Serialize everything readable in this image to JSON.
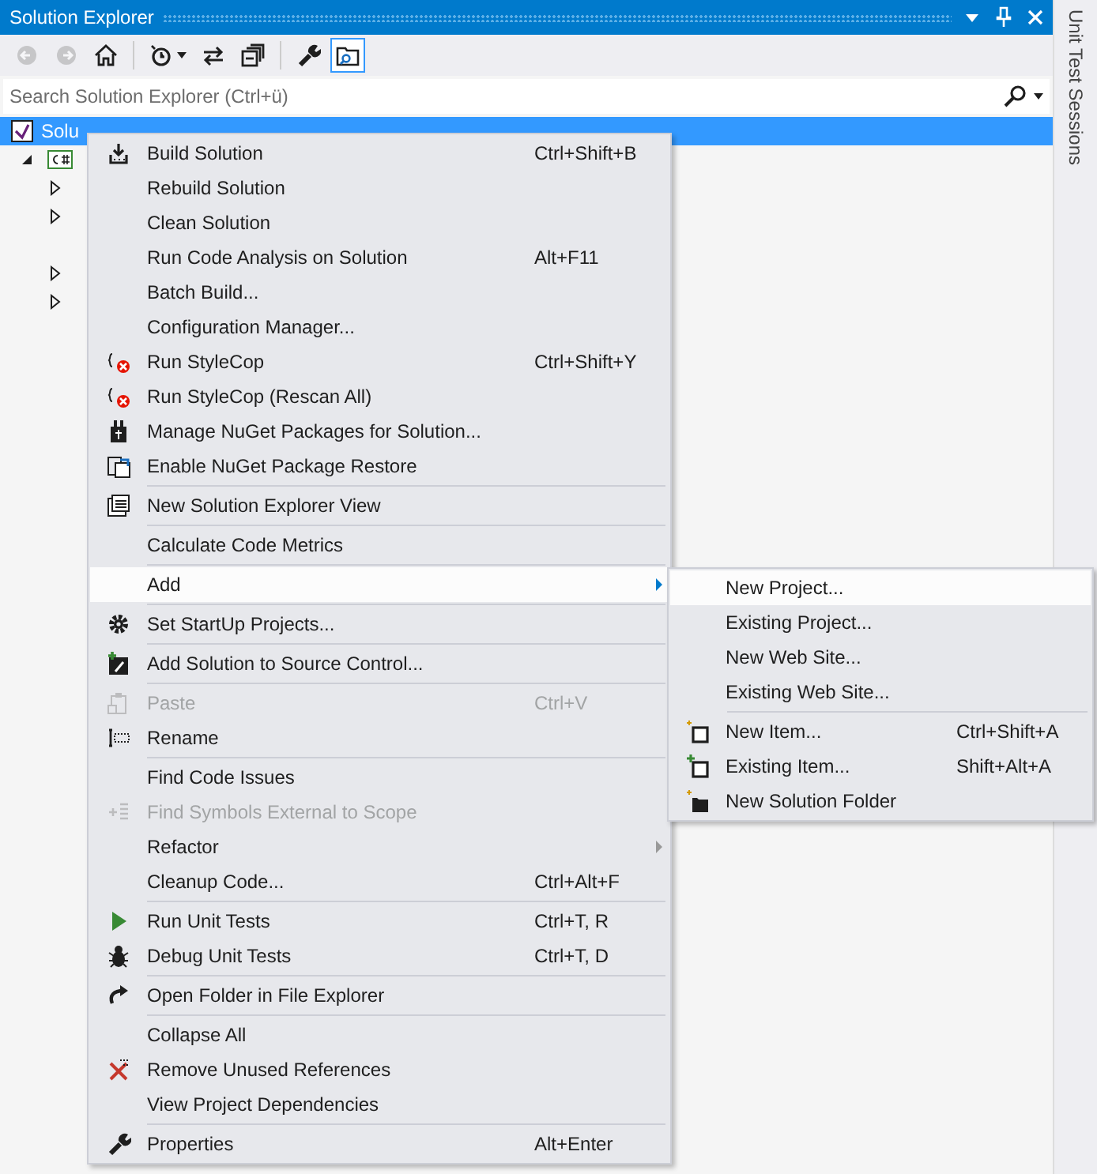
{
  "window": {
    "title": "Solution Explorer"
  },
  "side_tab": {
    "label": "Unit Test Sessions"
  },
  "toolbar": [
    {
      "kind": "button",
      "disabled": true,
      "selected": false
    },
    {
      "kind": "button",
      "disabled": true,
      "selected": false
    },
    {
      "kind": "button",
      "disabled": false,
      "selected": false
    },
    {
      "kind": "separator"
    },
    {
      "kind": "dropdown",
      "disabled": false,
      "selected": false
    },
    {
      "kind": "button",
      "disabled": false,
      "selected": false
    },
    {
      "kind": "button",
      "disabled": false,
      "selected": false
    },
    {
      "kind": "separator"
    },
    {
      "kind": "button",
      "disabled": false,
      "selected": false
    },
    {
      "kind": "button",
      "disabled": false,
      "selected": true
    }
  ],
  "search": {
    "placeholder": "Search Solution Explorer (Ctrl+ü)"
  },
  "tree": [
    {
      "label": "Solu",
      "selected": true,
      "children": [
        {
          "expanded": true,
          "selected": false,
          "children": [
            {
              "expanded": false,
              "selected": false
            },
            {
              "expanded": false,
              "selected": false
            },
            {
              "selected": false
            },
            {
              "expanded": false,
              "selected": false
            },
            {
              "expanded": false,
              "selected": false
            }
          ]
        }
      ]
    }
  ],
  "context_menu": {
    "groups": [
      {
        "items": [
          {
            "label": "Build Solution",
            "shortcut": "Ctrl+Shift+B",
            "disabled": false,
            "selected": false,
            "has_submenu": false
          },
          {
            "label": "Rebuild Solution",
            "disabled": false,
            "selected": false,
            "has_submenu": false
          },
          {
            "label": "Clean Solution",
            "disabled": false,
            "selected": false,
            "has_submenu": false
          },
          {
            "label": "Run Code Analysis on Solution",
            "shortcut": "Alt+F11",
            "disabled": false,
            "selected": false,
            "has_submenu": false
          },
          {
            "label": "Batch Build...",
            "disabled": false,
            "selected": false,
            "has_submenu": false
          },
          {
            "label": "Configuration Manager...",
            "disabled": false,
            "selected": false,
            "has_submenu": false
          },
          {
            "label": "Run StyleCop",
            "shortcut": "Ctrl+Shift+Y",
            "disabled": false,
            "selected": false,
            "has_submenu": false
          },
          {
            "label": "Run StyleCop (Rescan All)",
            "disabled": false,
            "selected": false,
            "has_submenu": false
          },
          {
            "label": "Manage NuGet Packages for Solution...",
            "disabled": false,
            "selected": false,
            "has_submenu": false
          },
          {
            "label": "Enable NuGet Package Restore",
            "disabled": false,
            "selected": false,
            "has_submenu": false
          }
        ]
      },
      {
        "items": [
          {
            "label": "New Solution Explorer View",
            "disabled": false,
            "selected": false,
            "has_submenu": false
          }
        ]
      },
      {
        "items": [
          {
            "label": "Calculate Code Metrics",
            "disabled": false,
            "selected": false,
            "has_submenu": false
          }
        ]
      },
      {
        "items": [
          {
            "label": "Add",
            "disabled": false,
            "selected": true,
            "has_submenu": true
          }
        ]
      },
      {
        "items": [
          {
            "label": "Set StartUp Projects...",
            "disabled": false,
            "selected": false,
            "has_submenu": false
          }
        ]
      },
      {
        "items": [
          {
            "label": "Add Solution to Source Control...",
            "disabled": false,
            "selected": false,
            "has_submenu": false
          }
        ]
      },
      {
        "items": [
          {
            "label": "Paste",
            "shortcut": "Ctrl+V",
            "disabled": true,
            "selected": false,
            "has_submenu": false
          },
          {
            "label": "Rename",
            "disabled": false,
            "selected": false,
            "has_submenu": false
          }
        ]
      },
      {
        "items": [
          {
            "label": "Find Code Issues",
            "disabled": false,
            "selected": false,
            "has_submenu": false
          },
          {
            "label": "Find Symbols External to Scope",
            "disabled": true,
            "selected": false,
            "has_submenu": false
          },
          {
            "label": "Refactor",
            "disabled": false,
            "selected": false,
            "has_submenu": true
          },
          {
            "label": "Cleanup Code...",
            "shortcut": "Ctrl+Alt+F",
            "disabled": false,
            "selected": false,
            "has_submenu": false
          }
        ]
      },
      {
        "items": [
          {
            "label": "Run Unit Tests",
            "shortcut": "Ctrl+T, R",
            "disabled": false,
            "selected": false,
            "has_submenu": false
          },
          {
            "label": "Debug Unit Tests",
            "shortcut": "Ctrl+T, D",
            "disabled": false,
            "selected": false,
            "has_submenu": false
          }
        ]
      },
      {
        "items": [
          {
            "label": "Open Folder in File Explorer",
            "disabled": false,
            "selected": false,
            "has_submenu": false
          }
        ]
      },
      {
        "items": [
          {
            "label": "Collapse All",
            "disabled": false,
            "selected": false,
            "has_submenu": false
          },
          {
            "label": "Remove Unused References",
            "disabled": false,
            "selected": false,
            "has_submenu": false
          },
          {
            "label": "View Project Dependencies",
            "disabled": false,
            "selected": false,
            "has_submenu": false
          }
        ]
      },
      {
        "items": [
          {
            "label": "Properties",
            "shortcut": "Alt+Enter",
            "disabled": false,
            "selected": false,
            "has_submenu": false
          }
        ]
      }
    ]
  },
  "submenu": {
    "groups": [
      {
        "items": [
          {
            "label": "New Project...",
            "disabled": false,
            "selected": true,
            "has_submenu": false
          },
          {
            "label": "Existing Project...",
            "disabled": false,
            "selected": false,
            "has_submenu": false
          },
          {
            "label": "New Web Site...",
            "disabled": false,
            "selected": false,
            "has_submenu": false
          },
          {
            "label": "Existing Web Site...",
            "disabled": false,
            "selected": false,
            "has_submenu": false
          }
        ]
      },
      {
        "items": [
          {
            "label": "New Item...",
            "shortcut": "Ctrl+Shift+A",
            "disabled": false,
            "selected": false,
            "has_submenu": false
          },
          {
            "label": "Existing Item...",
            "shortcut": "Shift+Alt+A",
            "disabled": false,
            "selected": false,
            "has_submenu": false
          },
          {
            "label": "New Solution Folder",
            "disabled": false,
            "selected": false,
            "has_submenu": false
          }
        ]
      }
    ]
  }
}
